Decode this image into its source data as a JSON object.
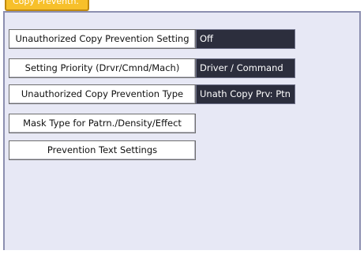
{
  "tab": {
    "label": "Copy Preventn."
  },
  "settings": [
    {
      "label": "Unauthorized Copy Prevention Setting",
      "value": "Off"
    },
    {
      "label": "Setting Priority (Drvr/Cmnd/Mach)",
      "value": "Driver / Command"
    },
    {
      "label": "Unauthorized Copy Prevention Type",
      "value": "Unath Copy Prv: Ptn"
    },
    {
      "label": "Mask Type for Patrn./Density/Effect",
      "value": null
    },
    {
      "label": "Prevention Text Settings",
      "value": null
    }
  ],
  "colors": {
    "tab": "#f7c02a",
    "panel": "#e7e8f5",
    "value_bg": "#2c2e3d",
    "border": "#8c8fb0"
  }
}
